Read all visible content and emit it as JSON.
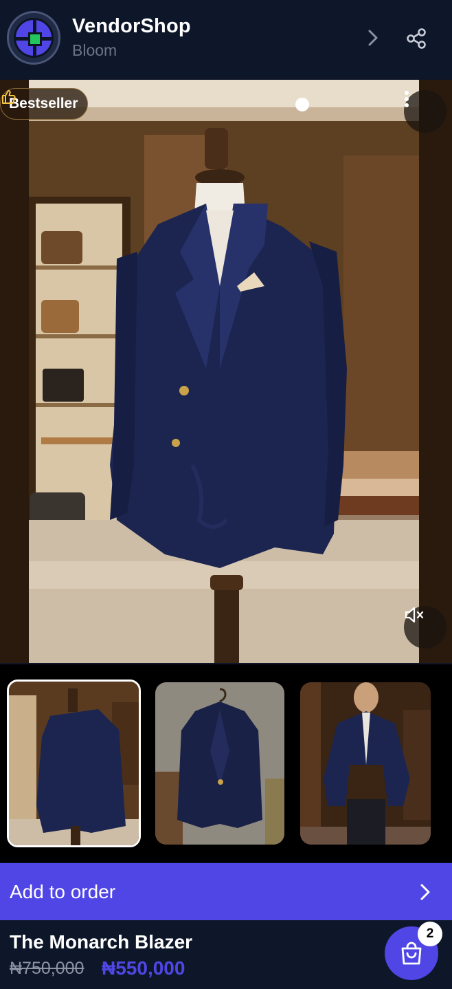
{
  "header": {
    "shop_name": "VendorShop",
    "shop_subtitle": "Bloom",
    "logo_icon": "vendorshop-logo",
    "chevron_icon": "chevron-right-icon",
    "share_icon": "share-icon"
  },
  "hero": {
    "badge_label": "Bestseller",
    "badge_icon": "thumbs-up-icon",
    "more_icon": "more-vertical-icon",
    "mute_icon": "volume-mute-icon"
  },
  "thumbnails": {
    "items": [
      {
        "name": "thumbnail-back-view",
        "selected": true
      },
      {
        "name": "thumbnail-hanger-view",
        "selected": false
      },
      {
        "name": "thumbnail-model-view",
        "selected": false
      }
    ]
  },
  "cta": {
    "label": "Add to order",
    "icon": "chevron-right-icon"
  },
  "footer": {
    "product_name": "The Monarch Blazer",
    "price_old": "₦750,000",
    "price_new": "₦550,000",
    "cart_icon": "shopping-bag-icon",
    "cart_count": "2"
  },
  "colors": {
    "background": "#0e1628",
    "accent": "#4f46e5",
    "muted_text": "#6b7488"
  }
}
